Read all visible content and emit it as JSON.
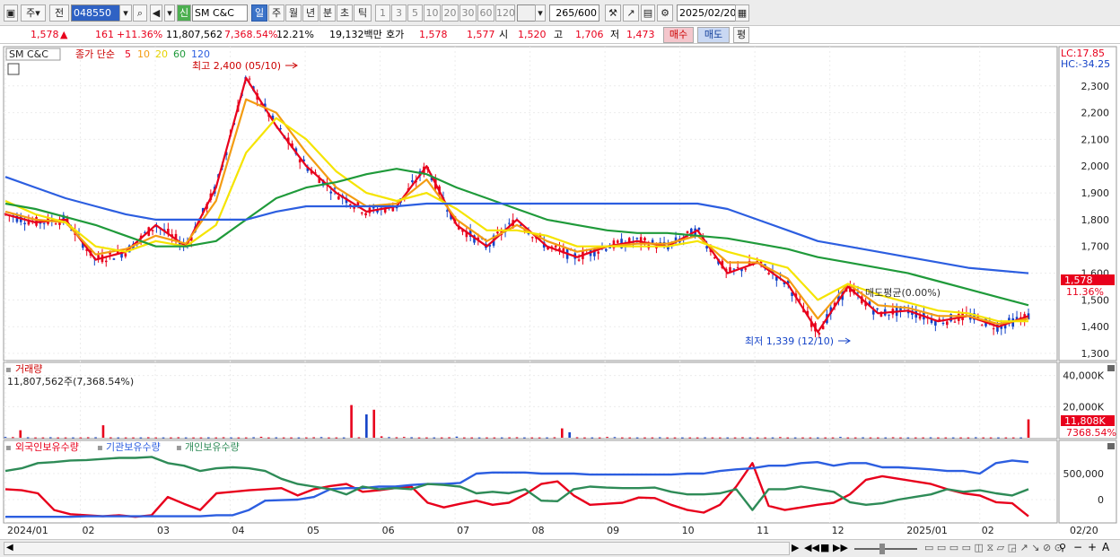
{
  "toolbar": {
    "market": "주",
    "prefix": "전",
    "code": "048550",
    "badge": "신",
    "name": "SM C&C",
    "periods": [
      "일",
      "주",
      "월",
      "년",
      "분",
      "초",
      "틱"
    ],
    "minutes": [
      "1",
      "3",
      "5",
      "10",
      "20",
      "30",
      "60",
      "120"
    ],
    "count": "265",
    "count_max": "/600",
    "date": "2025/02/20"
  },
  "quote": {
    "price": "1,578",
    "arrow": "▲",
    "change": "161",
    "change_pct": "+11.36%",
    "volume": "11,807,562",
    "volume_pct": "7,368.54%",
    "turnover": "12.21%",
    "amount": "19,132백만",
    "hoga_label": "호가",
    "ask": "1,578",
    "bid": "1,577",
    "open_label": "시",
    "open": "1,520",
    "high_label": "고",
    "high": "1,706",
    "low_label": "저",
    "low": "1,473",
    "buy": "매수",
    "sell": "매도",
    "eval": "평"
  },
  "price_panel": {
    "name": "SM C&C",
    "ma_label": "종가 단순",
    "ma_periods": [
      "5",
      "10",
      "20",
      "60",
      "120"
    ],
    "ma_colors": [
      "#e8001c",
      "#f39c12",
      "#f5e400",
      "#1f9a3a",
      "#2c5ee0"
    ],
    "lc": "LC:17.85",
    "hc": "HC:-34.25",
    "max_note": "최고 2,400 (05/10)",
    "min_note": "최저 1,339 (12/10)",
    "cost_note": "매도평균(0.00%)",
    "last_price": "1,578",
    "last_pct": "11.36%"
  },
  "volume_panel": {
    "title": "거래량",
    "value": "11,807,562주(7,368.54%)",
    "last": "11,808K",
    "last_pct": "7368.54%"
  },
  "holding_panel": {
    "series": [
      "외국인보유수량",
      "기관보유수량",
      "개인보유수량"
    ],
    "colors": [
      "#e8001c",
      "#2c5ee0",
      "#2e8b57"
    ]
  },
  "x_labels": [
    "2024/01",
    "02",
    "03",
    "04",
    "05",
    "06",
    "07",
    "08",
    "09",
    "10",
    "11",
    "12",
    "2025/01",
    "02",
    "02/20"
  ],
  "chart_data": [
    {
      "type": "line",
      "title": "SM C&C",
      "x": [
        "2024/01",
        "02",
        "03",
        "04",
        "05",
        "06",
        "07",
        "08",
        "09",
        "10",
        "11",
        "12",
        "2025/01",
        "02",
        "02/20"
      ],
      "ylim": [
        1280,
        2440
      ],
      "yticks": [
        1300,
        1400,
        1500,
        1600,
        1700,
        1800,
        1900,
        2000,
        2100,
        2200,
        2300
      ],
      "series": [
        {
          "name": "5",
          "values": [
            1820,
            1790,
            1800,
            1650,
            1680,
            1780,
            1700,
            1920,
            2330,
            2150,
            2000,
            1900,
            1830,
            1850,
            2000,
            1780,
            1700,
            1800,
            1700,
            1660,
            1700,
            1720,
            1700,
            1760,
            1600,
            1640,
            1560,
            1380,
            1550,
            1450,
            1460,
            1420,
            1440,
            1400,
            1440
          ]
        },
        {
          "name": "10",
          "values": [
            1830,
            1800,
            1790,
            1670,
            1690,
            1740,
            1710,
            1870,
            2250,
            2200,
            2050,
            1920,
            1850,
            1860,
            1950,
            1800,
            1720,
            1780,
            1720,
            1680,
            1700,
            1710,
            1710,
            1740,
            1640,
            1640,
            1580,
            1430,
            1560,
            1480,
            1470,
            1440,
            1440,
            1410,
            1430
          ]
        },
        {
          "name": "20",
          "values": [
            1870,
            1820,
            1790,
            1700,
            1680,
            1720,
            1700,
            1780,
            2050,
            2180,
            2100,
            1980,
            1900,
            1870,
            1900,
            1840,
            1760,
            1760,
            1740,
            1700,
            1700,
            1700,
            1700,
            1720,
            1680,
            1650,
            1620,
            1500,
            1560,
            1520,
            1490,
            1460,
            1450,
            1420,
            1420
          ]
        },
        {
          "name": "60",
          "values": [
            1860,
            1840,
            1810,
            1780,
            1740,
            1700,
            1700,
            1720,
            1800,
            1880,
            1920,
            1940,
            1970,
            1990,
            1970,
            1920,
            1880,
            1840,
            1800,
            1780,
            1760,
            1750,
            1750,
            1740,
            1730,
            1710,
            1690,
            1660,
            1640,
            1620,
            1600,
            1570,
            1540,
            1510,
            1480
          ]
        },
        {
          "name": "120",
          "values": [
            1960,
            1920,
            1880,
            1850,
            1820,
            1800,
            1800,
            1800,
            1800,
            1830,
            1850,
            1850,
            1850,
            1850,
            1860,
            1860,
            1860,
            1860,
            1860,
            1860,
            1860,
            1860,
            1860,
            1860,
            1840,
            1800,
            1760,
            1720,
            1700,
            1680,
            1660,
            1640,
            1620,
            1610,
            1600
          ]
        }
      ],
      "annotations": [
        {
          "text": "최고 2,400 (05/10)",
          "value": 2400
        },
        {
          "text": "최저 1,339 (12/10)",
          "value": 1339
        }
      ]
    },
    {
      "type": "bar",
      "title": "거래량",
      "x": [
        "2024/01",
        "02",
        "03",
        "04",
        "05",
        "06",
        "07",
        "08",
        "09",
        "10",
        "11",
        "12",
        "2025/01",
        "02",
        "02/20"
      ],
      "ylim": [
        0,
        45000
      ],
      "yticks": [
        20000,
        40000
      ],
      "ytick_labels": [
        "20,000K",
        "40,000K"
      ],
      "values": [
        500,
        400,
        4800,
        300,
        200,
        200,
        300,
        200,
        200,
        200,
        200,
        300,
        300,
        8000,
        250,
        200,
        200,
        200,
        200,
        300,
        200,
        200,
        200,
        300,
        200,
        200,
        200,
        250,
        200,
        300,
        200,
        200,
        200,
        300,
        600,
        200,
        250,
        200,
        200,
        200,
        200,
        300,
        400,
        200,
        200,
        200,
        21000,
        300,
        15000,
        18000,
        900,
        400,
        300,
        500,
        300,
        200,
        200,
        200,
        200,
        300,
        700,
        200,
        200,
        200,
        200,
        200,
        200,
        250,
        300,
        200,
        200,
        200,
        200,
        300,
        6000,
        3500,
        300,
        200,
        200,
        200,
        500,
        400,
        200,
        200,
        200,
        200,
        200,
        300,
        200,
        200,
        200,
        200,
        200,
        250,
        200,
        200,
        200,
        200,
        300,
        200,
        200,
        200,
        200,
        400,
        200,
        200,
        200,
        200,
        200,
        200,
        200,
        500,
        200,
        200,
        250,
        200,
        200,
        200,
        300,
        200,
        200,
        200,
        200,
        250,
        200,
        200,
        200,
        200,
        200,
        300,
        200,
        200,
        200,
        200,
        200,
        200,
        11808
      ]
    },
    {
      "type": "line",
      "title": "",
      "x": [
        "2024/01",
        "02",
        "03",
        "04",
        "05",
        "06",
        "07",
        "08",
        "09",
        "10",
        "11",
        "12",
        "2025/01",
        "02",
        "02/20"
      ],
      "ylim": [
        -430000,
        1050000
      ],
      "yticks": [
        0,
        500000
      ],
      "ytick_labels": [
        "0",
        "500,000"
      ],
      "series": [
        {
          "name": "외국인보유수량",
          "values": [
            200000,
            180000,
            120000,
            -200000,
            -280000,
            -300000,
            -320000,
            -300000,
            -330000,
            -300000,
            50000,
            -80000,
            -200000,
            120000,
            150000,
            180000,
            200000,
            220000,
            80000,
            200000,
            260000,
            300000,
            150000,
            180000,
            220000,
            250000,
            -60000,
            -150000,
            -80000,
            -20000,
            -100000,
            -60000,
            100000,
            300000,
            350000,
            80000,
            -100000,
            -80000,
            -60000,
            40000,
            30000,
            -100000,
            -200000,
            -250000,
            -100000,
            250000,
            700000,
            -120000,
            -200000,
            -150000,
            -100000,
            -60000,
            100000,
            380000,
            450000,
            400000,
            350000,
            300000,
            200000,
            120000,
            80000,
            -50000,
            -70000,
            -320000
          ]
        },
        {
          "name": "기관보유수량",
          "values": [
            -330000,
            -330000,
            -330000,
            -330000,
            -330000,
            -320000,
            -320000,
            -320000,
            -320000,
            -320000,
            -320000,
            -320000,
            -320000,
            -300000,
            -300000,
            -200000,
            -20000,
            -10000,
            0,
            50000,
            200000,
            220000,
            220000,
            250000,
            250000,
            280000,
            300000,
            300000,
            320000,
            500000,
            520000,
            520000,
            520000,
            500000,
            500000,
            500000,
            480000,
            480000,
            480000,
            480000,
            480000,
            480000,
            500000,
            500000,
            550000,
            580000,
            600000,
            650000,
            650000,
            700000,
            720000,
            650000,
            700000,
            700000,
            620000,
            620000,
            600000,
            580000,
            550000,
            550000,
            500000,
            700000,
            750000,
            720000
          ]
        },
        {
          "name": "개인보유수량",
          "values": [
            550000,
            600000,
            700000,
            720000,
            750000,
            760000,
            780000,
            800000,
            800000,
            820000,
            700000,
            650000,
            550000,
            600000,
            620000,
            600000,
            550000,
            400000,
            300000,
            250000,
            200000,
            100000,
            250000,
            200000,
            220000,
            200000,
            300000,
            280000,
            250000,
            120000,
            150000,
            120000,
            200000,
            -20000,
            -30000,
            200000,
            250000,
            230000,
            220000,
            220000,
            230000,
            150000,
            100000,
            100000,
            120000,
            200000,
            -200000,
            200000,
            200000,
            250000,
            200000,
            150000,
            -50000,
            -100000,
            -70000,
            0,
            50000,
            100000,
            200000,
            150000,
            180000,
            120000,
            80000,
            200000
          ]
        }
      ]
    }
  ]
}
